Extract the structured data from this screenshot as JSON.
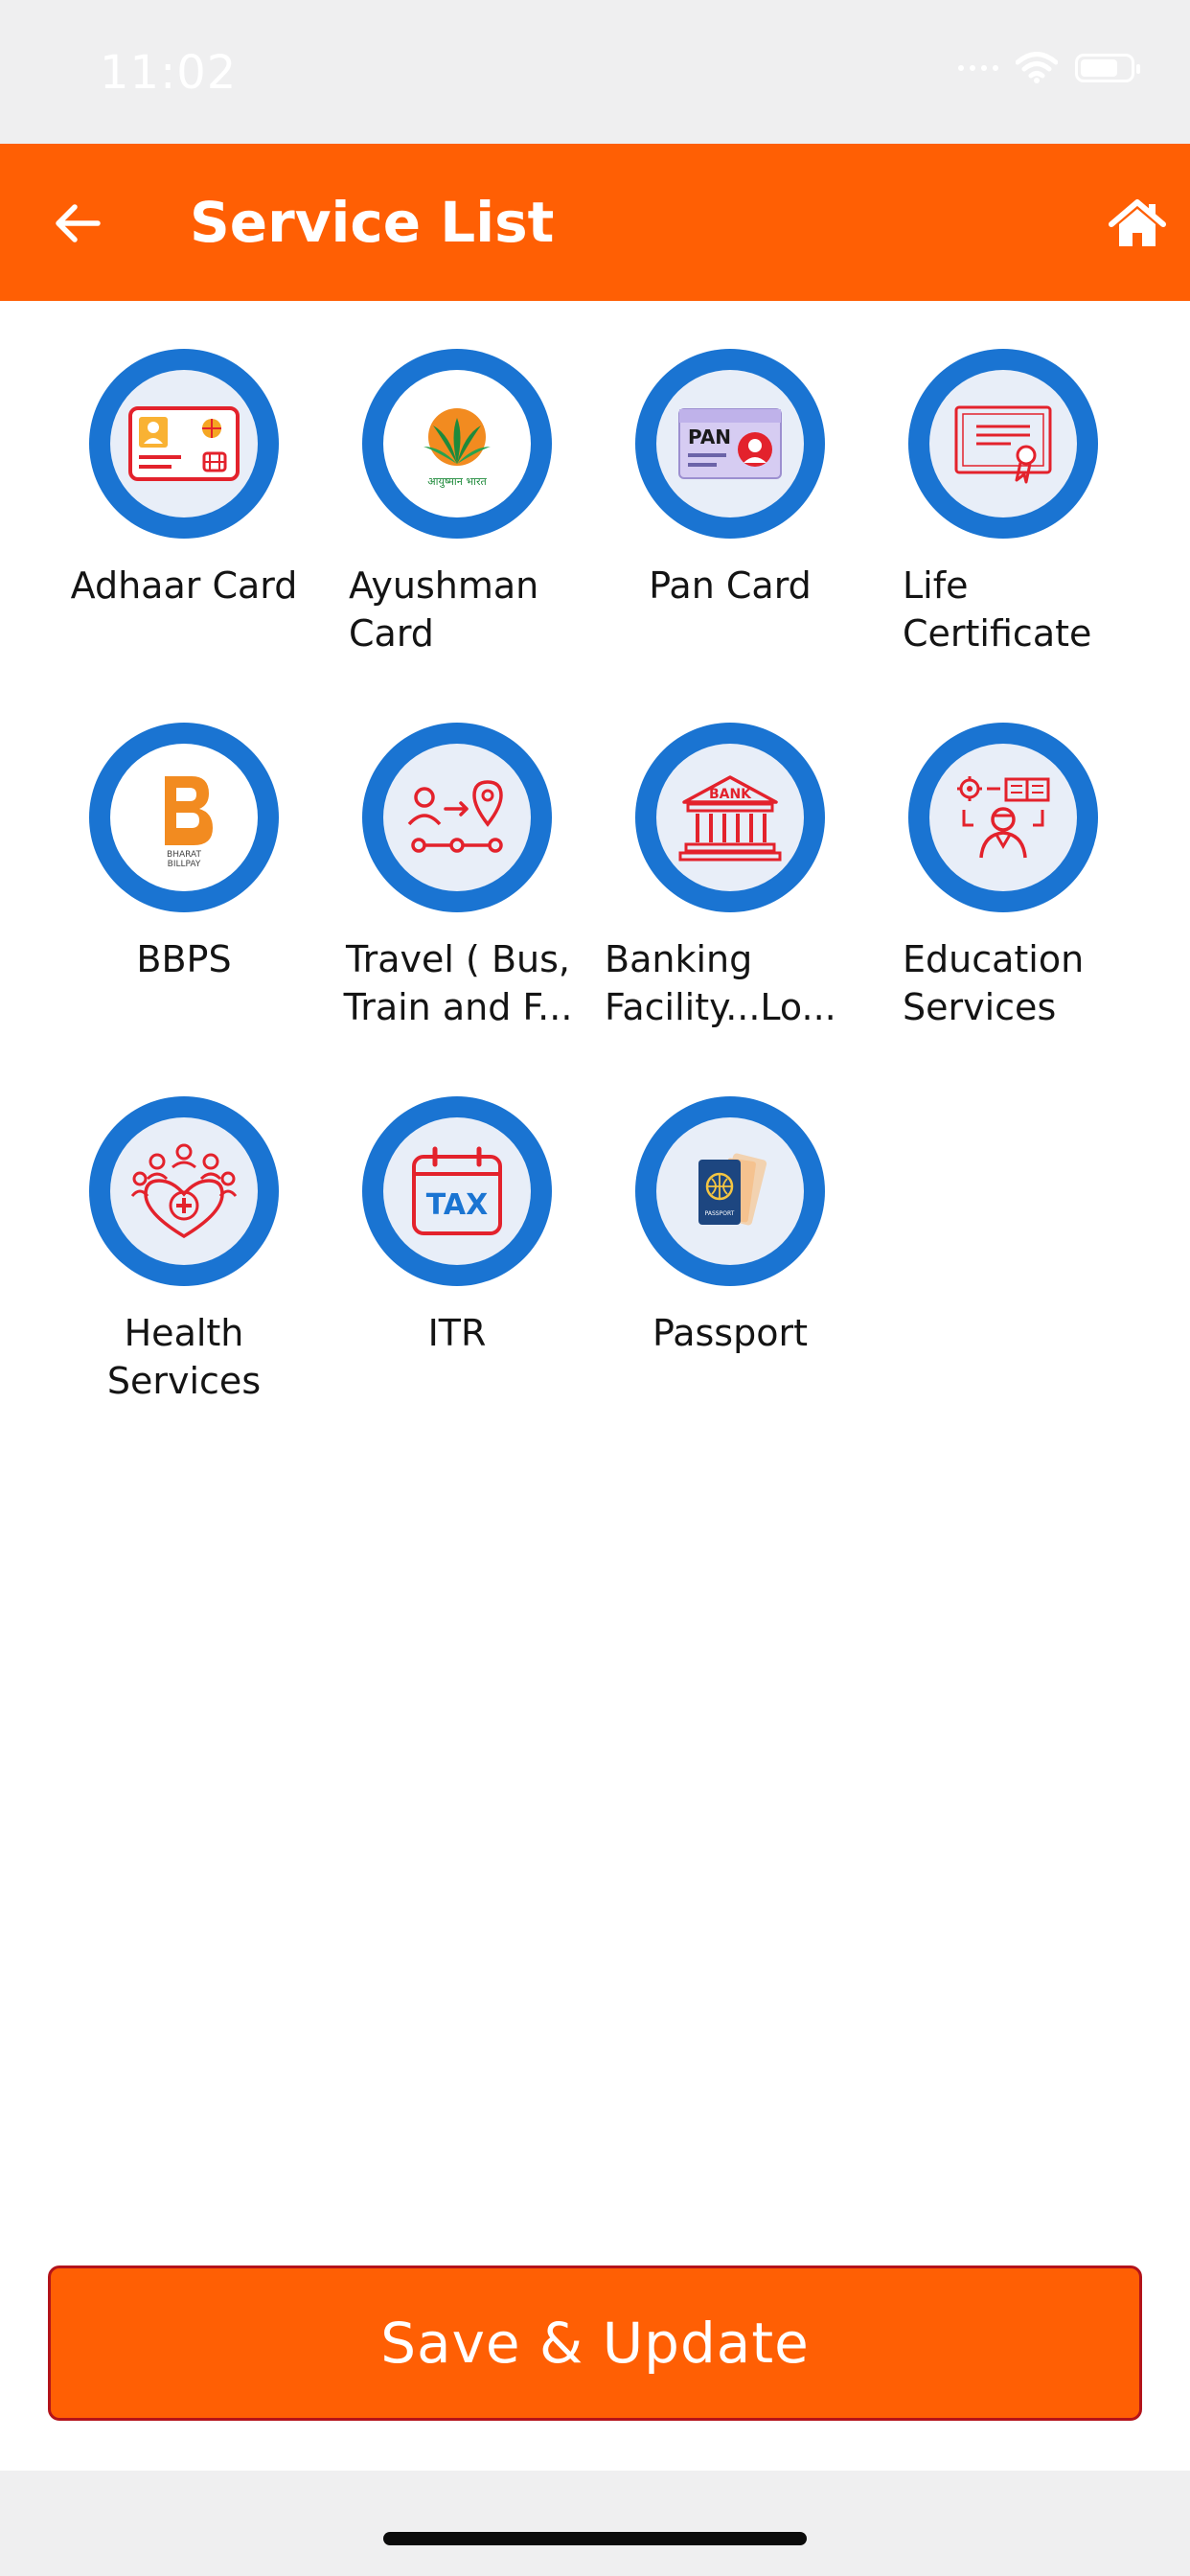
{
  "status_bar": {
    "time": "11:02"
  },
  "header": {
    "title": "Service List"
  },
  "services": [
    {
      "label": "Adhaar Card",
      "icon": "aadhaar-card-icon"
    },
    {
      "label": "Ayushman\nCard",
      "icon": "ayushman-bharat-icon",
      "logo_text": "आयुष्मान भारत"
    },
    {
      "label": "Pan Card",
      "icon": "pan-card-icon",
      "logo_text": "PAN"
    },
    {
      "label": "Life\nCertificate",
      "icon": "certificate-icon"
    },
    {
      "label": "BBPS",
      "icon": "bharat-billpay-icon",
      "logo_text": "BHARAT\nBILLPAY"
    },
    {
      "label": "Travel ( Bus,\nTrain and  F...",
      "icon": "travel-route-icon"
    },
    {
      "label": "Banking\nFacility...Lo...",
      "icon": "bank-building-icon",
      "logo_text": "BANK"
    },
    {
      "label": "Education\nServices",
      "icon": "education-services-icon"
    },
    {
      "label": "Health\nServices",
      "icon": "health-heart-icon"
    },
    {
      "label": "ITR",
      "icon": "tax-calendar-icon",
      "logo_text": "TAX"
    },
    {
      "label": "Passport",
      "icon": "passport-icon",
      "logo_text": "PASSPORT"
    }
  ],
  "footer": {
    "save_label": "Save & Update"
  },
  "colors": {
    "accent": "#ff5f04",
    "ring": "#1a74d2",
    "ring_inner": "#e8eef8",
    "icon_red": "#e3222c",
    "button_border": "#b3131a"
  }
}
